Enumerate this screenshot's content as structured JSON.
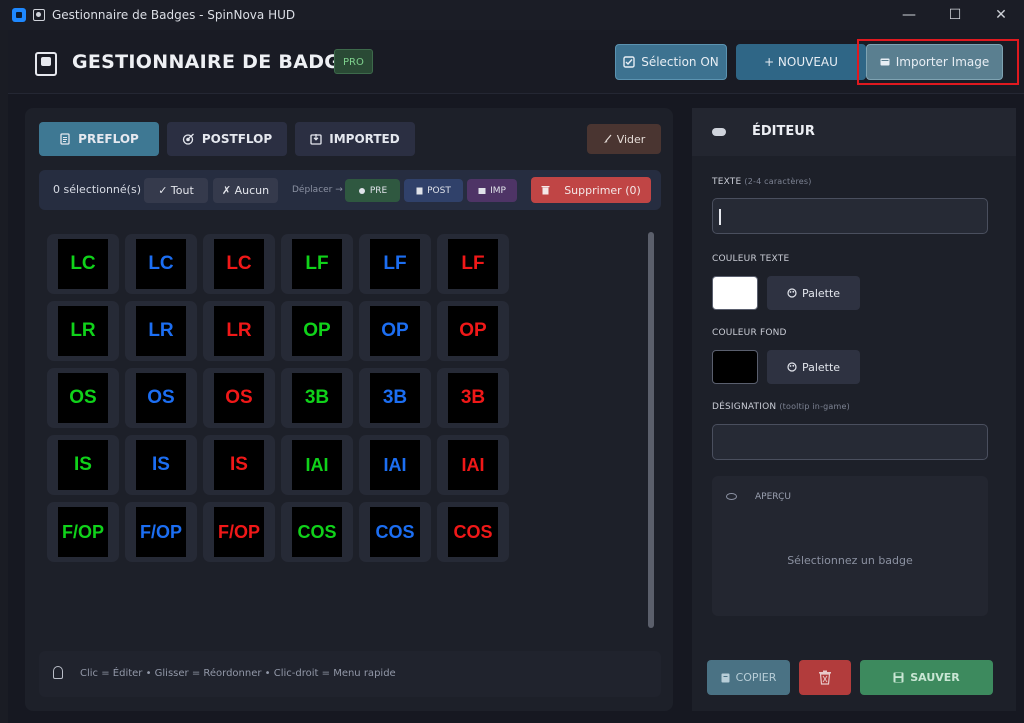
{
  "window": {
    "title": "Gestionnaire de Badges - SpinNova HUD",
    "controls": {
      "minimize": "—",
      "maximize": "☐",
      "close": "✕"
    }
  },
  "header": {
    "title": "GESTIONNAIRE DE BADGES",
    "pro_badge": "PRO",
    "selection_button": "Sélection ON",
    "new_button": "+ NOUVEAU",
    "import_button": "Importer Image"
  },
  "tabs": {
    "preflop": "PREFLOP",
    "postflop": "POSTFLOP",
    "imported": "IMPORTED",
    "vider": "Vider"
  },
  "selection_bar": {
    "count": "0 sélectionné(s)",
    "tout": "✓ Tout",
    "aucun": "✗ Aucun",
    "deplacer": "Déplacer →",
    "pre": "PRE",
    "post": "POST",
    "imp": "IMP",
    "supprimer": "Supprimer (0)"
  },
  "badges": [
    [
      {
        "text": "LC",
        "color": "#10d21a"
      },
      {
        "text": "LC",
        "color": "#1c6ef2"
      },
      {
        "text": "LC",
        "color": "#f01818"
      },
      {
        "text": "LF",
        "color": "#10d21a"
      },
      {
        "text": "LF",
        "color": "#1c6ef2"
      },
      {
        "text": "LF",
        "color": "#f01818"
      }
    ],
    [
      {
        "text": "LR",
        "color": "#10d21a"
      },
      {
        "text": "LR",
        "color": "#1c6ef2"
      },
      {
        "text": "LR",
        "color": "#f01818"
      },
      {
        "text": "OP",
        "color": "#10d21a"
      },
      {
        "text": "OP",
        "color": "#1c6ef2"
      },
      {
        "text": "OP",
        "color": "#f01818"
      }
    ],
    [
      {
        "text": "OS",
        "color": "#10d21a"
      },
      {
        "text": "OS",
        "color": "#1c6ef2"
      },
      {
        "text": "OS",
        "color": "#f01818"
      },
      {
        "text": "3B",
        "color": "#10d21a"
      },
      {
        "text": "3B",
        "color": "#1c6ef2"
      },
      {
        "text": "3B",
        "color": "#f01818"
      }
    ],
    [
      {
        "text": "IS",
        "color": "#10d21a"
      },
      {
        "text": "IS",
        "color": "#1c6ef2"
      },
      {
        "text": "IS",
        "color": "#f01818"
      },
      {
        "text": "IAI",
        "color": "#10d21a"
      },
      {
        "text": "IAI",
        "color": "#1c6ef2"
      },
      {
        "text": "IAI",
        "color": "#f01818"
      }
    ],
    [
      {
        "text": "F/OP",
        "color": "#10d21a"
      },
      {
        "text": "F/OP",
        "color": "#1c6ef2"
      },
      {
        "text": "F/OP",
        "color": "#f01818"
      },
      {
        "text": "COS",
        "color": "#10d21a"
      },
      {
        "text": "COS",
        "color": "#1c6ef2"
      },
      {
        "text": "COS",
        "color": "#f01818"
      }
    ]
  ],
  "hint": "Clic = Éditer  •  Glisser = Réordonner  •  Clic-droit = Menu rapide",
  "editor": {
    "title": "ÉDITEUR",
    "texte_label": "TEXTE",
    "texte_hint": "(2-4 caractères)",
    "texte_value": "",
    "couleur_texte_label": "COULEUR TEXTE",
    "couleur_texte_value": "#ffffff",
    "couleur_fond_label": "COULEUR FOND",
    "couleur_fond_value": "#000000",
    "palette": "Palette",
    "designation_label": "DÉSIGNATION",
    "designation_hint": "(tooltip in-game)",
    "designation_value": "",
    "apercu_label": "APERÇU",
    "apercu_empty": "Sélectionnez un badge",
    "copier": "COPIER",
    "sauver": "SAUVER"
  }
}
